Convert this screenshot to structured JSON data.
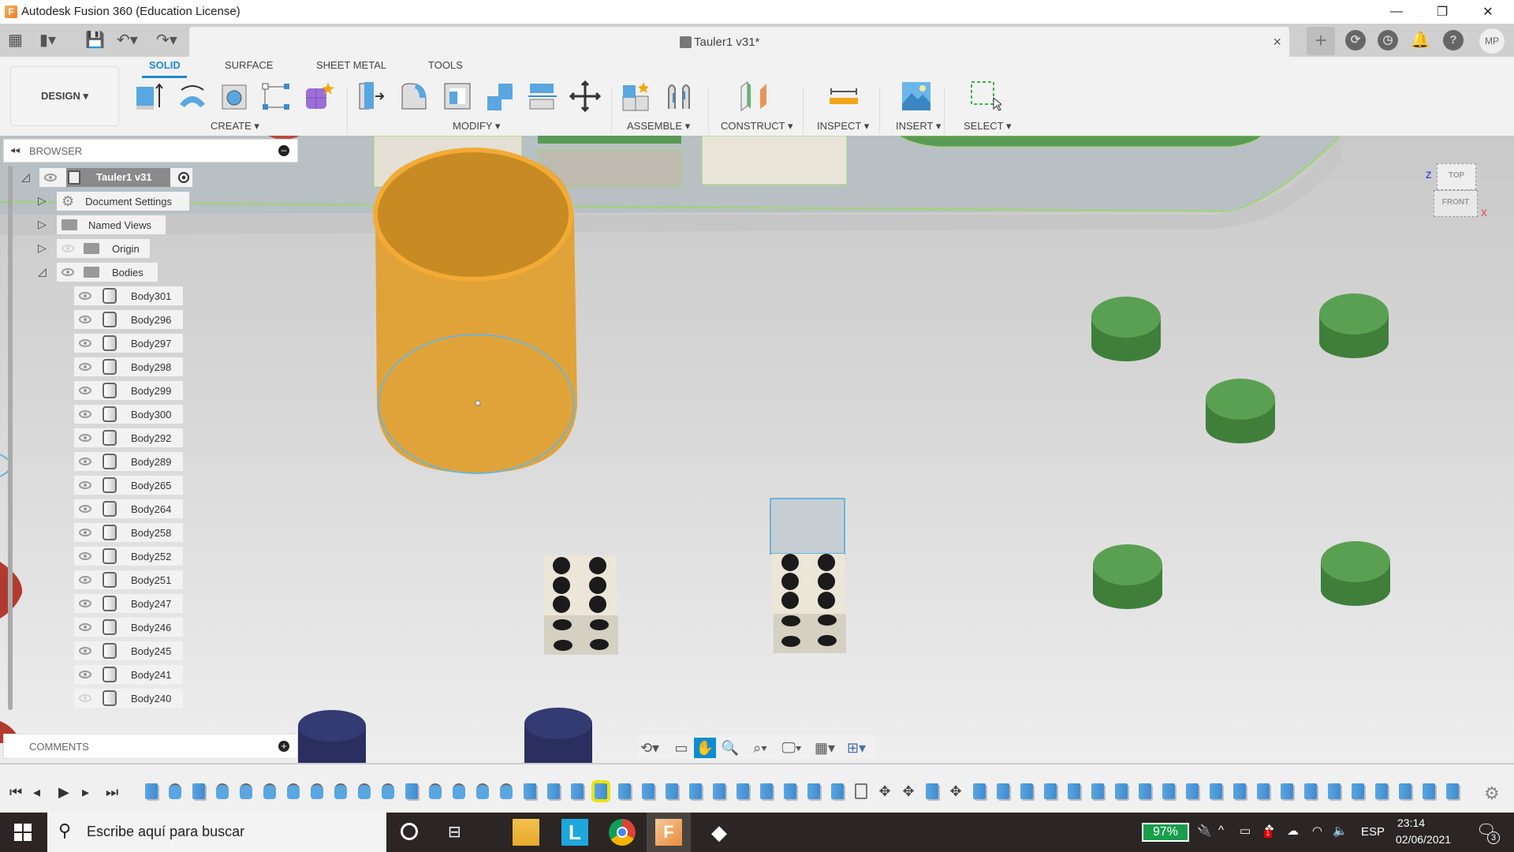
{
  "window": {
    "title": "Autodesk Fusion 360 (Education License)",
    "minimize": "—",
    "maximize": "❐",
    "close": "✕"
  },
  "qat": {
    "document_tab": "Tauler1 v31*",
    "tab_close": "×",
    "new_tab": "+",
    "user_initials": "MP"
  },
  "ribbon": {
    "workspace": "DESIGN ▾",
    "tabs": [
      {
        "label": "SOLID",
        "active": true
      },
      {
        "label": "SURFACE",
        "active": false
      },
      {
        "label": "SHEET METAL",
        "active": false
      },
      {
        "label": "TOOLS",
        "active": false
      }
    ],
    "groups": [
      {
        "label": "CREATE ▾",
        "tools": [
          "extrude",
          "revolve",
          "hole",
          "sketch-pattern",
          "create-form"
        ]
      },
      {
        "label": "MODIFY ▾",
        "tools": [
          "press-pull",
          "fillet",
          "shell",
          "combine",
          "split-body",
          "move"
        ]
      },
      {
        "label": "ASSEMBLE ▾",
        "tools": [
          "new-component",
          "joint"
        ]
      },
      {
        "label": "CONSTRUCT ▾",
        "tools": [
          "offset-plane"
        ]
      },
      {
        "label": "INSPECT ▾",
        "tools": [
          "measure"
        ]
      },
      {
        "label": "INSERT ▾",
        "tools": [
          "insert-image"
        ]
      },
      {
        "label": "SELECT ▾",
        "tools": [
          "window-select"
        ]
      }
    ]
  },
  "browser": {
    "title": "BROWSER",
    "root": "Tauler1 v31",
    "folders": [
      {
        "label": "Document Settings",
        "icon": "gear"
      },
      {
        "label": "Named Views",
        "icon": "folder"
      },
      {
        "label": "Origin",
        "icon": "folder",
        "visible": false
      },
      {
        "label": "Bodies",
        "icon": "folder",
        "expanded": true
      }
    ],
    "bodies": [
      {
        "name": "Body301",
        "visible": true
      },
      {
        "name": "Body296",
        "visible": true
      },
      {
        "name": "Body297",
        "visible": true
      },
      {
        "name": "Body298",
        "visible": true
      },
      {
        "name": "Body299",
        "visible": true
      },
      {
        "name": "Body300",
        "visible": true
      },
      {
        "name": "Body292",
        "visible": true
      },
      {
        "name": "Body289",
        "visible": true
      },
      {
        "name": "Body265",
        "visible": true
      },
      {
        "name": "Body264",
        "visible": true
      },
      {
        "name": "Body258",
        "visible": true
      },
      {
        "name": "Body252",
        "visible": true
      },
      {
        "name": "Body251",
        "visible": true
      },
      {
        "name": "Body247",
        "visible": true
      },
      {
        "name": "Body246",
        "visible": true
      },
      {
        "name": "Body245",
        "visible": true
      },
      {
        "name": "Body241",
        "visible": true
      },
      {
        "name": "Body240",
        "visible": false
      }
    ]
  },
  "comments": {
    "title": "COMMENTS"
  },
  "viewcube": {
    "top": "TOP",
    "front": "FRONT",
    "axis_z": "Z",
    "axis_x": "X"
  },
  "navbar": {
    "active": "pan"
  },
  "timeline": {
    "features": [
      "extrude",
      "revolve",
      "extrude",
      "revolve",
      "revolve",
      "revolve",
      "revolve",
      "revolve",
      "revolve",
      "revolve",
      "revolve",
      "extrude",
      "revolve",
      "revolve",
      "revolve",
      "revolve",
      "extrude",
      "extrude",
      "extrude",
      "extrude",
      "extrude",
      "extrude",
      "extrude",
      "extrude",
      "extrude",
      "extrude",
      "extrude",
      "extrude",
      "extrude",
      "extrude",
      "shell",
      "move",
      "move",
      "extrude",
      "move",
      "extrude",
      "extrude",
      "extrude",
      "extrude",
      "extrude",
      "extrude",
      "extrude",
      "extrude",
      "extrude",
      "extrude",
      "extrude",
      "extrude",
      "extrude",
      "extrude",
      "extrude",
      "extrude",
      "extrude",
      "extrude",
      "extrude",
      "extrude",
      "extrude"
    ],
    "selected_index": 19
  },
  "taskbar": {
    "search_placeholder": "Escribe aquí para buscar",
    "battery": "97%",
    "language": "ESP",
    "time": "23:14",
    "date": "02/06/2021",
    "notifications": "3",
    "dropbox_badge": "1"
  }
}
